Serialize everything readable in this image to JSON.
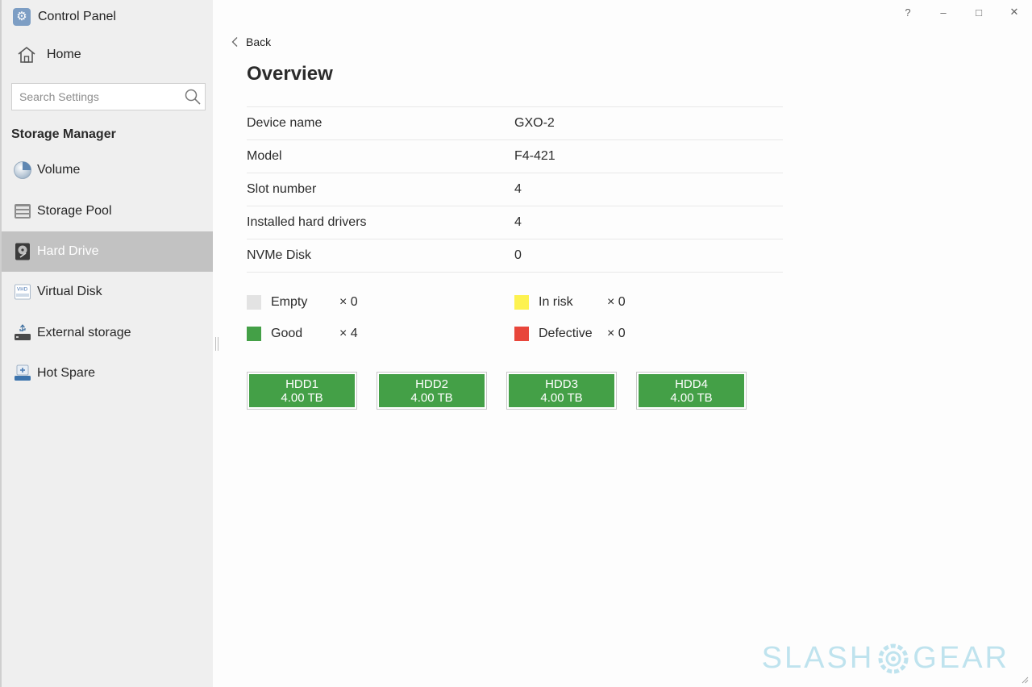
{
  "app": {
    "title": "Control Panel"
  },
  "window_controls": {
    "help": "?",
    "minimize": "–",
    "maximize": "□",
    "close": "✕"
  },
  "sidebar": {
    "home_label": "Home",
    "search": {
      "placeholder": "Search Settings",
      "value": ""
    },
    "section_title": "Storage Manager",
    "items": [
      {
        "label": "Volume",
        "icon": "pie-chart-icon",
        "active": false
      },
      {
        "label": "Storage Pool",
        "icon": "storage-pool-icon",
        "active": false
      },
      {
        "label": "Hard Drive",
        "icon": "hard-drive-icon",
        "active": true
      },
      {
        "label": "Virtual Disk",
        "icon": "vhd-icon",
        "active": false
      },
      {
        "label": "External storage",
        "icon": "usb-icon",
        "active": false
      },
      {
        "label": "Hot Spare",
        "icon": "hot-spare-icon",
        "active": false
      }
    ]
  },
  "main": {
    "back_label": "Back",
    "title": "Overview",
    "info": [
      {
        "key": "Device name",
        "value": "GXO-2"
      },
      {
        "key": "Model",
        "value": "F4-421"
      },
      {
        "key": "Slot number",
        "value": "4"
      },
      {
        "key": "Installed hard drivers",
        "value": "4"
      },
      {
        "key": "NVMe Disk",
        "value": "0"
      }
    ],
    "legend": [
      {
        "label": "Empty",
        "count": "× 0",
        "color": "#e3e3e3"
      },
      {
        "label": "In risk",
        "count": "× 0",
        "color": "#fdf250"
      },
      {
        "label": "Good",
        "count": "× 4",
        "color": "#44a047"
      },
      {
        "label": "Defective",
        "count": "× 0",
        "color": "#e8463b"
      }
    ],
    "drives": [
      {
        "name": "HDD1",
        "size": "4.00 TB",
        "status": "good"
      },
      {
        "name": "HDD2",
        "size": "4.00 TB",
        "status": "good"
      },
      {
        "name": "HDD3",
        "size": "4.00 TB",
        "status": "good"
      },
      {
        "name": "HDD4",
        "size": "4.00 TB",
        "status": "good"
      }
    ]
  },
  "watermark": {
    "left": "SLASH",
    "right": "GEAR"
  }
}
